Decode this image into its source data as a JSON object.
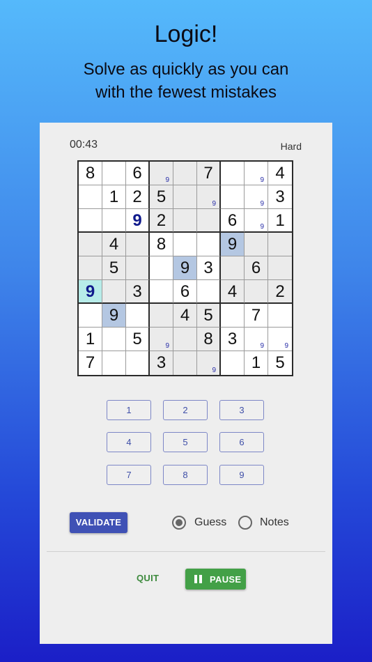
{
  "header": {
    "title": "Logic!",
    "subtitle_line1": "Solve as quickly as you can",
    "subtitle_line2": "with the fewest mistakes"
  },
  "game": {
    "timer": "00:43",
    "difficulty": "Hard",
    "grid": [
      [
        {
          "v": "8"
        },
        {
          "v": ""
        },
        {
          "v": "6"
        },
        {
          "v": "",
          "n": "9",
          "sh": 1
        },
        {
          "v": "",
          "sh": 1
        },
        {
          "v": "7",
          "sh": 1
        },
        {
          "v": ""
        },
        {
          "v": "",
          "n": "9"
        },
        {
          "v": "4"
        }
      ],
      [
        {
          "v": ""
        },
        {
          "v": "1"
        },
        {
          "v": "2"
        },
        {
          "v": "5",
          "sh": 1
        },
        {
          "v": "",
          "sh": 1
        },
        {
          "v": "",
          "n": "9",
          "sh": 1
        },
        {
          "v": ""
        },
        {
          "v": "",
          "n": "9"
        },
        {
          "v": "3"
        }
      ],
      [
        {
          "v": ""
        },
        {
          "v": ""
        },
        {
          "v": "9",
          "g": 1
        },
        {
          "v": "2",
          "sh": 1
        },
        {
          "v": "",
          "sh": 1
        },
        {
          "v": "",
          "sh": 1
        },
        {
          "v": "6"
        },
        {
          "v": "",
          "n": "9"
        },
        {
          "v": "1"
        }
      ],
      [
        {
          "v": "",
          "sh": 1
        },
        {
          "v": "4",
          "sh": 1
        },
        {
          "v": "",
          "sh": 1
        },
        {
          "v": "8"
        },
        {
          "v": ""
        },
        {
          "v": ""
        },
        {
          "v": "9",
          "sel": 1
        },
        {
          "v": "",
          "sh": 1
        },
        {
          "v": "",
          "sh": 1
        }
      ],
      [
        {
          "v": "",
          "sh": 1
        },
        {
          "v": "5",
          "sh": 1
        },
        {
          "v": "",
          "sh": 1
        },
        {
          "v": ""
        },
        {
          "v": "9",
          "sel": 1
        },
        {
          "v": "3"
        },
        {
          "v": "",
          "sh": 1
        },
        {
          "v": "6",
          "sh": 1
        },
        {
          "v": "",
          "sh": 1
        }
      ],
      [
        {
          "v": "9",
          "g": 1,
          "cur": 1
        },
        {
          "v": "",
          "sh": 1
        },
        {
          "v": "3",
          "sh": 1
        },
        {
          "v": ""
        },
        {
          "v": "6"
        },
        {
          "v": ""
        },
        {
          "v": "4",
          "sh": 1
        },
        {
          "v": "",
          "sh": 1
        },
        {
          "v": "2",
          "sh": 1
        }
      ],
      [
        {
          "v": ""
        },
        {
          "v": "9",
          "sel": 1
        },
        {
          "v": ""
        },
        {
          "v": "",
          "sh": 1
        },
        {
          "v": "4",
          "sh": 1
        },
        {
          "v": "5",
          "sh": 1
        },
        {
          "v": ""
        },
        {
          "v": "7"
        },
        {
          "v": ""
        }
      ],
      [
        {
          "v": "1"
        },
        {
          "v": ""
        },
        {
          "v": "5"
        },
        {
          "v": "",
          "n": "9",
          "sh": 1
        },
        {
          "v": "",
          "sh": 1
        },
        {
          "v": "8",
          "sh": 1
        },
        {
          "v": "3"
        },
        {
          "v": "",
          "n": "9"
        },
        {
          "v": "",
          "n": "9"
        }
      ],
      [
        {
          "v": "7"
        },
        {
          "v": ""
        },
        {
          "v": ""
        },
        {
          "v": "3",
          "sh": 1
        },
        {
          "v": "",
          "sh": 1
        },
        {
          "v": "",
          "n": "9",
          "sh": 1
        },
        {
          "v": ""
        },
        {
          "v": "1"
        },
        {
          "v": "5"
        }
      ]
    ]
  },
  "keypad": [
    "1",
    "2",
    "3",
    "4",
    "5",
    "6",
    "7",
    "8",
    "9"
  ],
  "controls": {
    "validate_label": "VALIDATE",
    "mode_guess_label": "Guess",
    "mode_notes_label": "Notes",
    "selected_mode": "Guess",
    "quit_label": "QUIT",
    "pause_label": "PAUSE"
  },
  "colors": {
    "selected_cell": "#b4c7e2",
    "current_cell": "#b7ece9",
    "shaded_box": "#ebebeb",
    "guess_digit": "#101a8c",
    "validate_button": "#3f51b5",
    "pause_button": "#43a047"
  }
}
